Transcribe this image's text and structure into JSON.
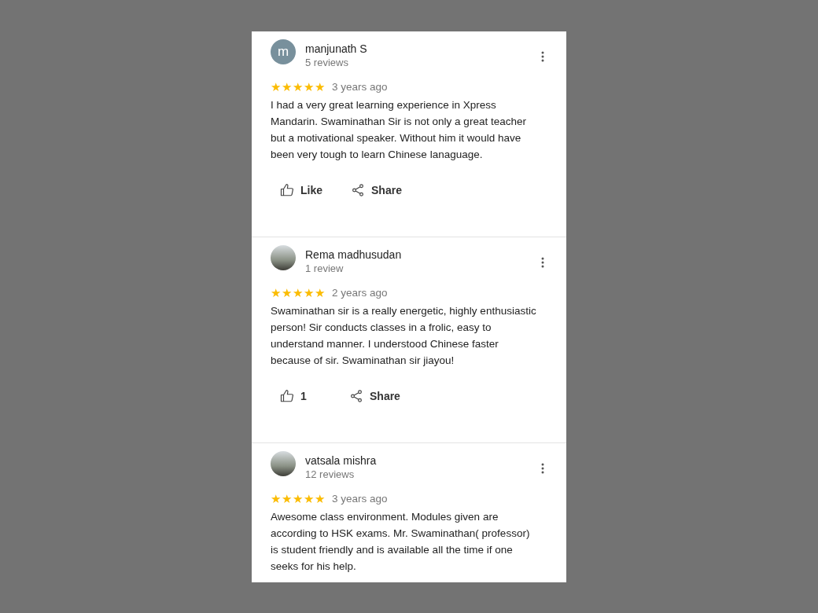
{
  "reviews": [
    {
      "author": "manjunath S",
      "review_count": "5 reviews",
      "avatar": {
        "kind": "letter",
        "letter": "m"
      },
      "stars": 5,
      "time": "3 years ago",
      "text": "I had a very great learning experience in Xpress Mandarin. Swaminathan Sir is not only a great teacher but a motivational speaker. Without him it would have been very tough to learn Chinese lanaguage.",
      "actions": {
        "like": "Like",
        "share": "Share"
      }
    },
    {
      "author": "Rema madhusudan",
      "review_count": "1 review",
      "avatar": {
        "kind": "photo"
      },
      "stars": 5,
      "time": "2 years ago",
      "text": "Swaminathan sir is a really energetic, highly enthusiastic person! Sir conducts classes in a frolic, easy to understand manner. I understood Chinese faster because of sir. Swaminathan sir jiayou!",
      "actions": {
        "like": "1",
        "share": "Share"
      }
    },
    {
      "author": "vatsala mishra",
      "review_count": "12 reviews",
      "avatar": {
        "kind": "photo"
      },
      "stars": 5,
      "time": "3 years ago",
      "text": "Awesome class environment. Modules given are according to HSK exams. Mr. Swaminathan( professor) is student friendly and is available all the time if one seeks for his help."
    }
  ]
}
